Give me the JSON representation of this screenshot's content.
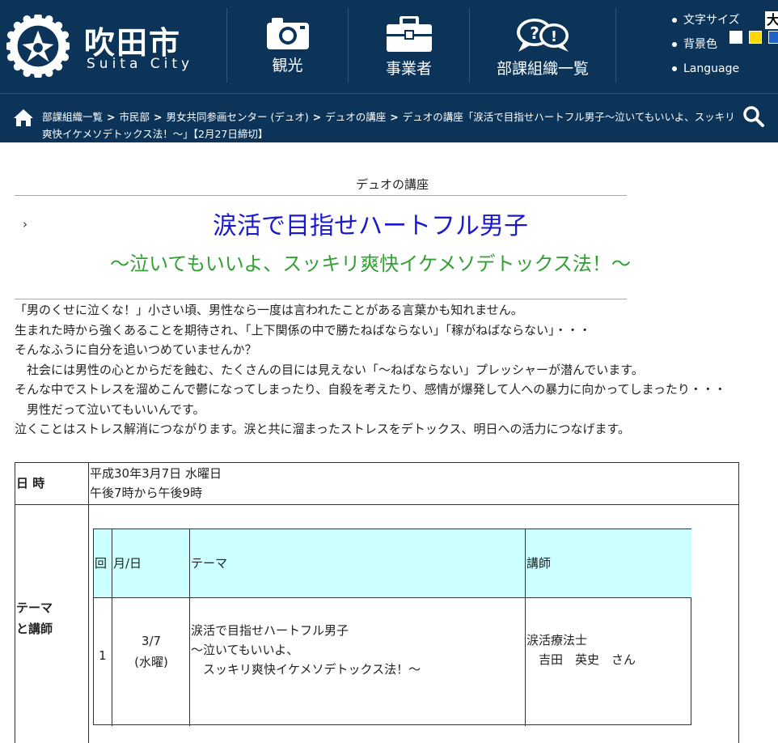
{
  "header": {
    "site_name": "吹田市",
    "site_sub": "Suita City",
    "nav": [
      {
        "label": "観光",
        "icon": "camera-icon"
      },
      {
        "label": "事業者",
        "icon": "briefcase-icon"
      },
      {
        "label": "部課組織一覧",
        "icon": "speech-bubbles-icon"
      }
    ],
    "util": {
      "font_size_label": "文字サイズ",
      "font_size_value": "大",
      "bg_color_label": "背景色",
      "bg_swatches": [
        "#ffffff",
        "#ffd700",
        "#1e64c8"
      ],
      "language_label": "Language"
    }
  },
  "breadcrumb": {
    "items": [
      "部課組織一覧",
      "市民部",
      "男女共同参画センター (デュオ)",
      "デュオの講座"
    ],
    "current": "デュオの講座「涙活で目指せハートフル男子～泣いてもいいよ、スッキリ爽快イケメソデトックス法！～」【2月27日締切】"
  },
  "content": {
    "section_label": "デュオの講座",
    "chevron": "›",
    "title_main": "涙活で目指せハートフル男子",
    "title_sub": "～泣いてもいいよ、スッキリ爽快イケメソデトックス法！～",
    "paragraphs": [
      "「男のくせに泣くな！」小さい頃、男性なら一度は言われたことがある言葉かも知れません。",
      "生まれた時から強くあることを期待され、「上下関係の中で勝たねばならない」「稼がねばならない」・・・",
      "そんなふうに自分を追いつめていませんか？",
      "　社会には男性の心とからだを蝕む、たくさんの目には見えない「～ねばならない」プレッシャーが潜んでいます。",
      "そんな中でストレスを溜めこんで鬱になってしまったり、自殺を考えたり、感情が爆発して人への暴力に向かってしまったり・・・",
      "　男性だって泣いてもいいんです。",
      "泣くことはストレス解消につながります。涙と共に溜まったストレスをデトックス、明日への活力につなげます。"
    ]
  },
  "table": {
    "datetime_label": "日 時",
    "datetime_line1": "平成30年3月7日 水曜日",
    "datetime_line2": "午後7時から午後9時",
    "theme_label_line1": "テーマ",
    "theme_label_line2": "と講師",
    "inner": {
      "headers": [
        "回",
        "月/日",
        "テーマ",
        "講師"
      ],
      "row": {
        "no": "1",
        "date_line1": "3/7",
        "date_line2": "(水曜)",
        "theme_line1": "涙活で目指せハートフル男子",
        "theme_line2": "～泣いてもいいよ、",
        "theme_line3": "　スッキリ爽快イケメソデトックス法！～",
        "lecturer_line1": "涙活療法士",
        "lecturer_line2": "　吉田　英史　さん"
      }
    }
  }
}
